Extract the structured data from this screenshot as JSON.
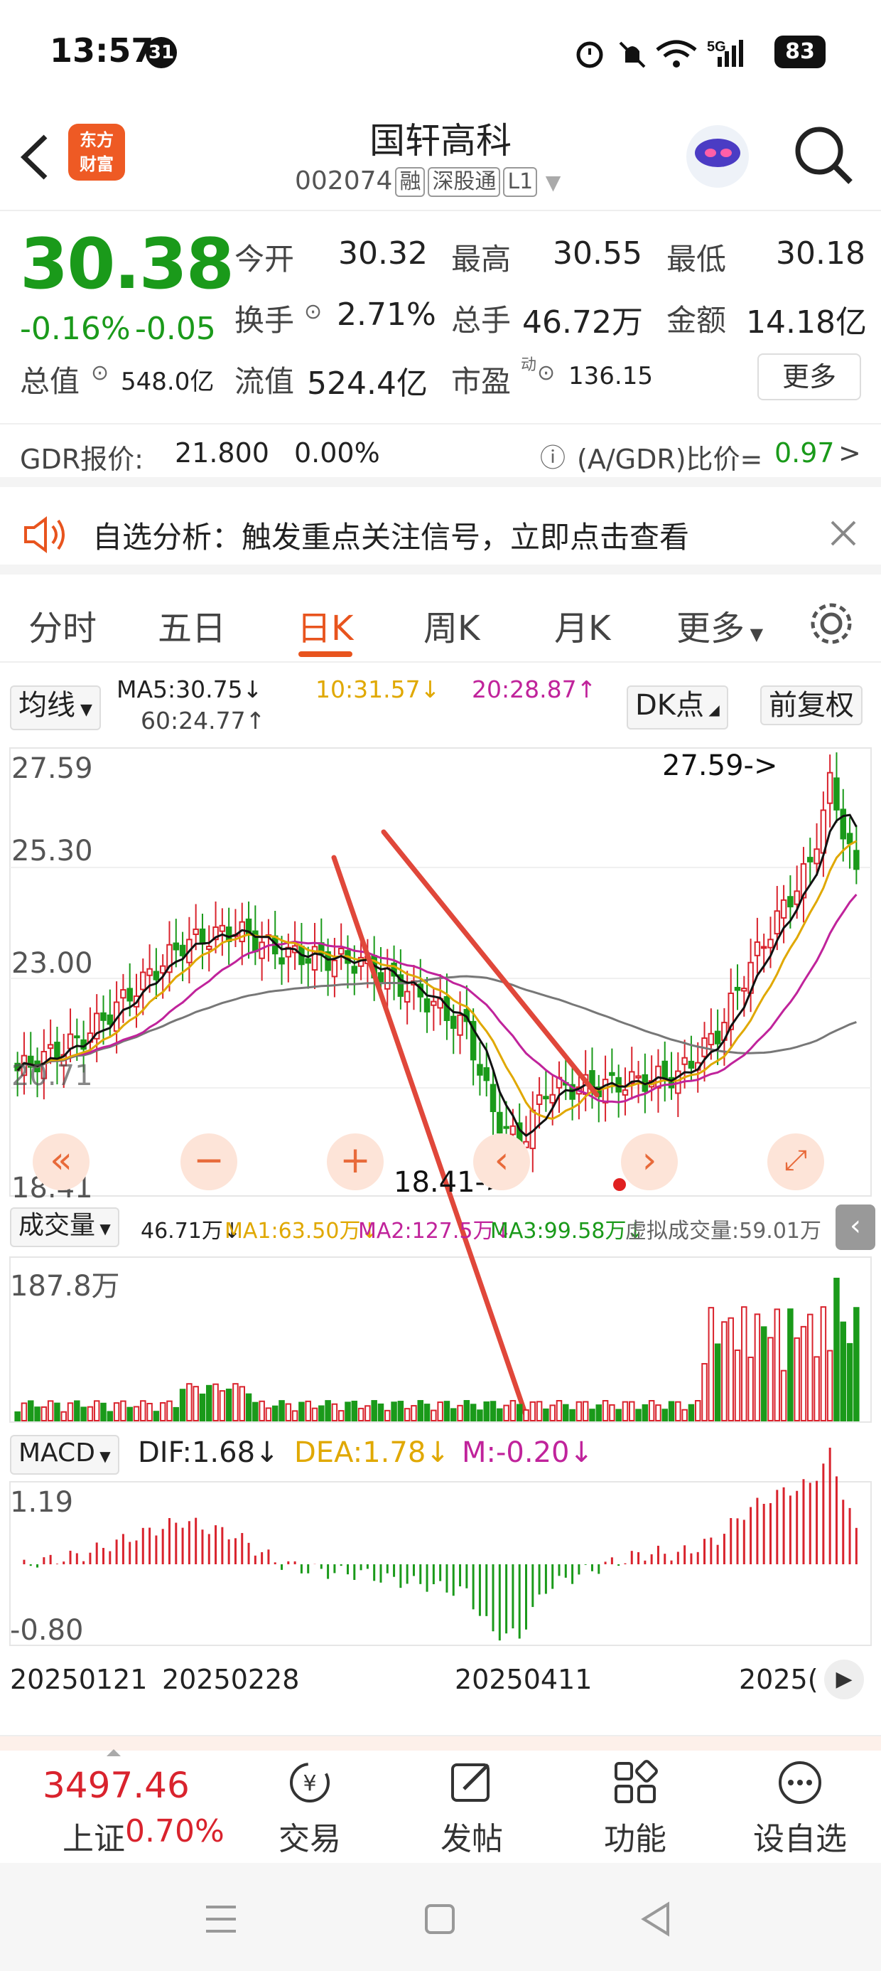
{
  "status": {
    "time": "13:57",
    "notif_count": "31",
    "network": "5G",
    "battery": "83"
  },
  "header": {
    "title": "国轩高科",
    "code": "002074",
    "tags": [
      "融",
      "深股通",
      "L1"
    ],
    "logo": [
      "东方",
      "财富"
    ]
  },
  "quote": {
    "price": "30.38",
    "change_pct": "-0.16%",
    "change": "-0.05",
    "open_label": "今开",
    "open": "30.32",
    "high_label": "最高",
    "high": "30.55",
    "low_label": "最低",
    "low": "30.18",
    "turnover_label": "换手",
    "turnover": "2.71%",
    "volume_label": "总手",
    "volume": "46.72万",
    "amount_label": "金额",
    "amount": "14.18亿",
    "mktcap_label": "总值",
    "mktcap": "548.0亿",
    "float_label": "流值",
    "float": "524.4亿",
    "pe_label": "市盈",
    "pe_sup": "动",
    "pe": "136.15",
    "more": "更多"
  },
  "gdr": {
    "label": "GDR报价:",
    "price": "21.800",
    "pct": "0.00%",
    "ratio_label": "(A/GDR)比价=",
    "ratio": "0.97",
    "arrow": ">"
  },
  "alert": {
    "text": "自选分析：触发重点关注信号，立即点击查看"
  },
  "tabs": [
    "分时",
    "五日",
    "日K",
    "周K",
    "月K",
    "更多"
  ],
  "ma_bar": {
    "type": "均线",
    "ma5": "MA5:30.75↓",
    "ma10": "10:31.57↓",
    "ma20": "20:28.87↑",
    "ma60": "60:24.77↑",
    "dk": "DK点",
    "adjust": "前复权"
  },
  "volume_bar": {
    "type": "成交量",
    "vol": "46.71万↓",
    "ma1": "MA1:63.50万↓",
    "ma2": "MA2:127.5万↓",
    "ma3": "MA3:99.58万↓",
    "virtual": "虚拟成交量:59.01万"
  },
  "macd_bar": {
    "type": "MACD",
    "dif": "DIF:1.68↓",
    "dea": "DEA:1.78↓",
    "m": "M:-0.20↓"
  },
  "colors": {
    "up": "#d9232d",
    "down": "#1a9a1a",
    "accent": "#e8541e"
  },
  "chart_data": {
    "type": "candlestick",
    "price_axis": {
      "top": "27.59",
      "mid1": "25.30",
      "mid2": "23.00",
      "low_partial": "20.71",
      "bottom": "18.41"
    },
    "annotations": {
      "max": "27.59->",
      "min": "18.41->"
    },
    "volume_axis": {
      "top": "187.8万"
    },
    "macd_axis": {
      "top": "1.19",
      "bottom": "-0.80"
    },
    "dates": [
      "20250121",
      "20250228",
      "20250411",
      "2025("
    ]
  },
  "bottom": {
    "index_value": "3497.46",
    "index_name": "上证",
    "index_pct": "0.70%",
    "nav": [
      "交易",
      "发帖",
      "功能",
      "设自选"
    ]
  }
}
